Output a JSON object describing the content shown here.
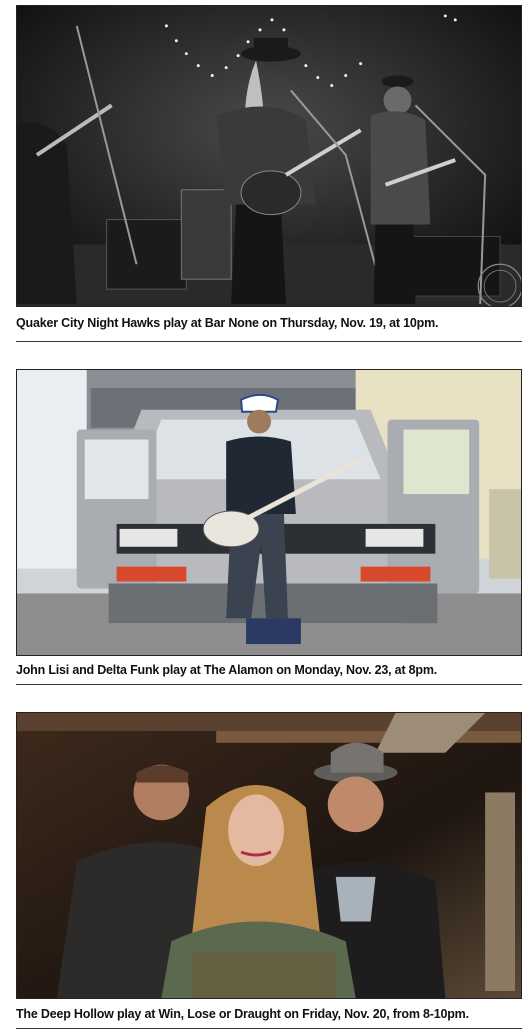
{
  "photos": [
    {
      "caption": "Quaker City Night Hawks play at Bar None on Thursday, Nov. 19, at 10pm.",
      "description": "Band performing on stage, black and white"
    },
    {
      "caption": "John Lisi and Delta Funk play at The Alamon on Monday, Nov. 23, at 8pm.",
      "description": "Musician with guitar sitting on front of a silver van"
    },
    {
      "caption": "The Deep Hollow play at Win, Lose or Draught on Friday, Nov. 20, from 8-10pm.",
      "description": "Three band members portrait"
    }
  ],
  "colors": {
    "rule": "#333333",
    "caption_text": "#111111"
  }
}
